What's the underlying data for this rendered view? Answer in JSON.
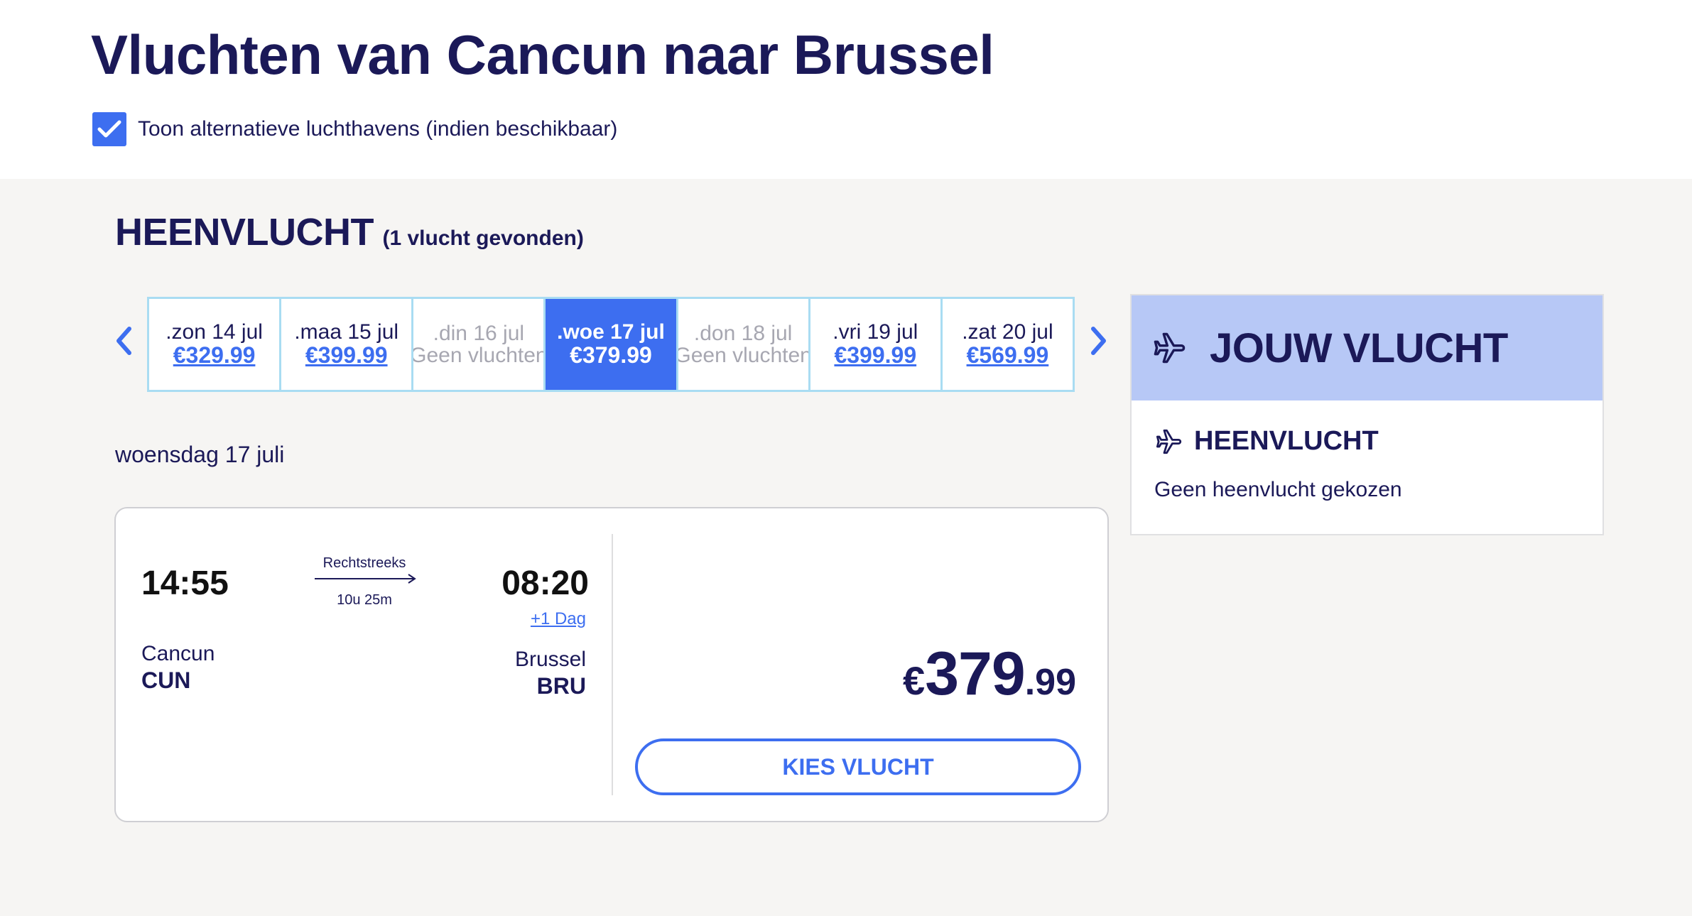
{
  "page": {
    "title": "Vluchten van Cancun naar Brussel",
    "alt_airports_label": "Toon alternatieve luchthavens (indien beschikbaar)",
    "alt_airports_checked": true
  },
  "outbound": {
    "title": "HEENVLUCHT",
    "count_label": "(1 vlucht gevonden)",
    "dates": [
      {
        "day": ".zon 14 jul",
        "price": "€329.99",
        "state": "available"
      },
      {
        "day": ".maa 15 jul",
        "price": "€399.99",
        "state": "available"
      },
      {
        "day": ".din 16 jul",
        "price": "Geen vluchten",
        "state": "disabled"
      },
      {
        "day": ".woe 17 jul",
        "price": "€379.99",
        "state": "selected"
      },
      {
        "day": ".don 18 jul",
        "price": "Geen vluchten",
        "state": "disabled"
      },
      {
        "day": ".vri 19 jul",
        "price": "€399.99",
        "state": "available"
      },
      {
        "day": ".zat 20 jul",
        "price": "€569.99",
        "state": "available"
      }
    ],
    "selected_day_label": "woensdag 17 juli"
  },
  "flight": {
    "departure_time": "14:55",
    "arrival_time": "08:20",
    "stops": "Rechtstreeks",
    "duration": "10u 25m",
    "next_day": "+1 Dag",
    "departure_city": "Cancun",
    "departure_code": "CUN",
    "arrival_city": "Brussel",
    "arrival_code": "BRU",
    "price_currency": "€",
    "price_main": "379",
    "price_decimals": ".99",
    "select_label": "KIES VLUCHT"
  },
  "summary": {
    "title": "JOUW VLUCHT",
    "outbound_label": "HEENVLUCHT",
    "empty_text": "Geen heenvlucht gekozen"
  },
  "colors": {
    "navy": "#1b1958",
    "accent": "#3d6ef0",
    "summary_header": "#b7c8f6",
    "page_bg": "#f6f5f3",
    "strip_border": "#a9dcf2"
  },
  "icons": {
    "checkbox": "check-icon",
    "prev": "chevron-left-icon",
    "next": "chevron-right-icon",
    "plane": "plane-icon",
    "route": "arrow-right-icon"
  }
}
